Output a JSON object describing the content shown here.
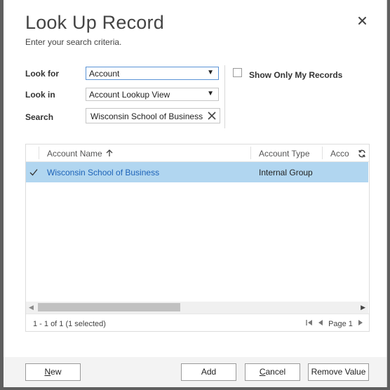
{
  "dialog": {
    "title": "Look Up Record",
    "subtitle": "Enter your search criteria."
  },
  "form": {
    "look_for_label": "Look for",
    "look_for_value": "Account",
    "look_in_label": "Look in",
    "look_in_value": "Account Lookup View",
    "search_label": "Search",
    "search_value": "Wisconsin School of Business",
    "show_only_my_records_label": "Show Only My Records",
    "show_only_my_records_checked": false
  },
  "grid": {
    "columns": [
      "Account Name",
      "Account Type",
      "Acco"
    ],
    "sort_column": "Account Name",
    "sort_direction": "ascending",
    "rows": [
      {
        "account_name": "Wisconsin School of Business",
        "account_type": "Internal Group",
        "selected": true
      }
    ],
    "status": "1 - 1 of 1 (1 selected)",
    "page_label": "Page 1"
  },
  "buttons": {
    "new_label": "ew",
    "new_mnemonic": "N",
    "add_label": "Add",
    "cancel_label": "ancel",
    "cancel_mnemonic": "C",
    "remove_label": "Remove Value"
  },
  "icons": {
    "close": "close-icon",
    "sort": "arrow-up-icon",
    "refresh": "refresh-icon",
    "clear": "clear-icon",
    "check": "checkmark-icon"
  },
  "colors": {
    "selected_row": "#b1d6f0",
    "link": "#1d63b8",
    "overlay": "#5f5f5f"
  }
}
